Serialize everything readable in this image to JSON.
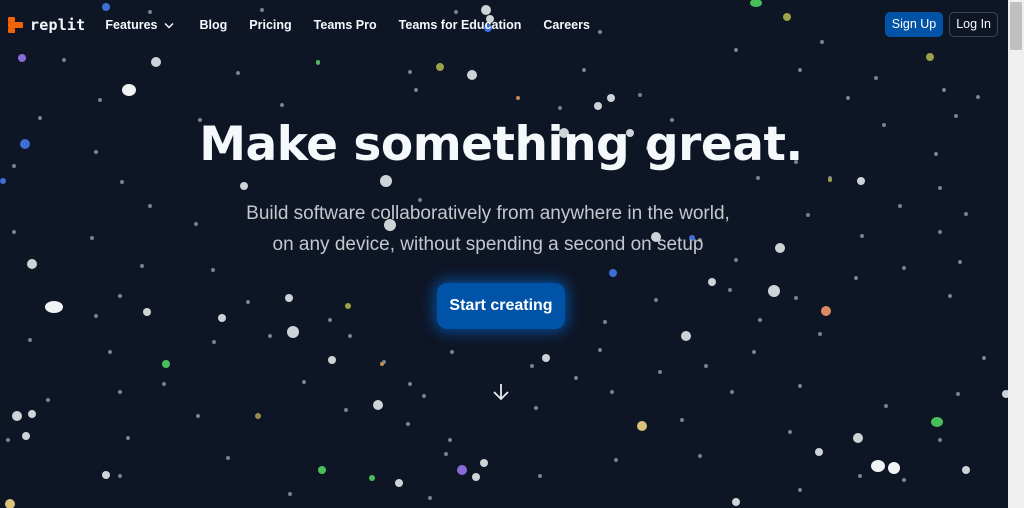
{
  "nav": {
    "logo_text": "replit",
    "links": [
      {
        "label": "Features",
        "has_dropdown": true
      },
      {
        "label": "Blog"
      },
      {
        "label": "Pricing"
      },
      {
        "label": "Teams Pro"
      },
      {
        "label": "Teams for Education"
      },
      {
        "label": "Careers"
      }
    ],
    "sign_up": "Sign Up",
    "log_in": "Log In"
  },
  "hero": {
    "title": "Make something great.",
    "subtitle_line1": "Build software collaboratively from anywhere in the world,",
    "subtitle_line2": "on any device, without spending a second on setup",
    "cta": "Start creating"
  },
  "icons": {
    "logo": "replit-logo-icon",
    "dropdown": "chevron-down-icon",
    "scroll_down": "arrow-down-icon"
  },
  "colors": {
    "background": "#0e1525",
    "primary": "#0053a6",
    "brand_orange": "#f26207",
    "text": "#f5f9fc",
    "muted_text": "#c2c8cc"
  }
}
